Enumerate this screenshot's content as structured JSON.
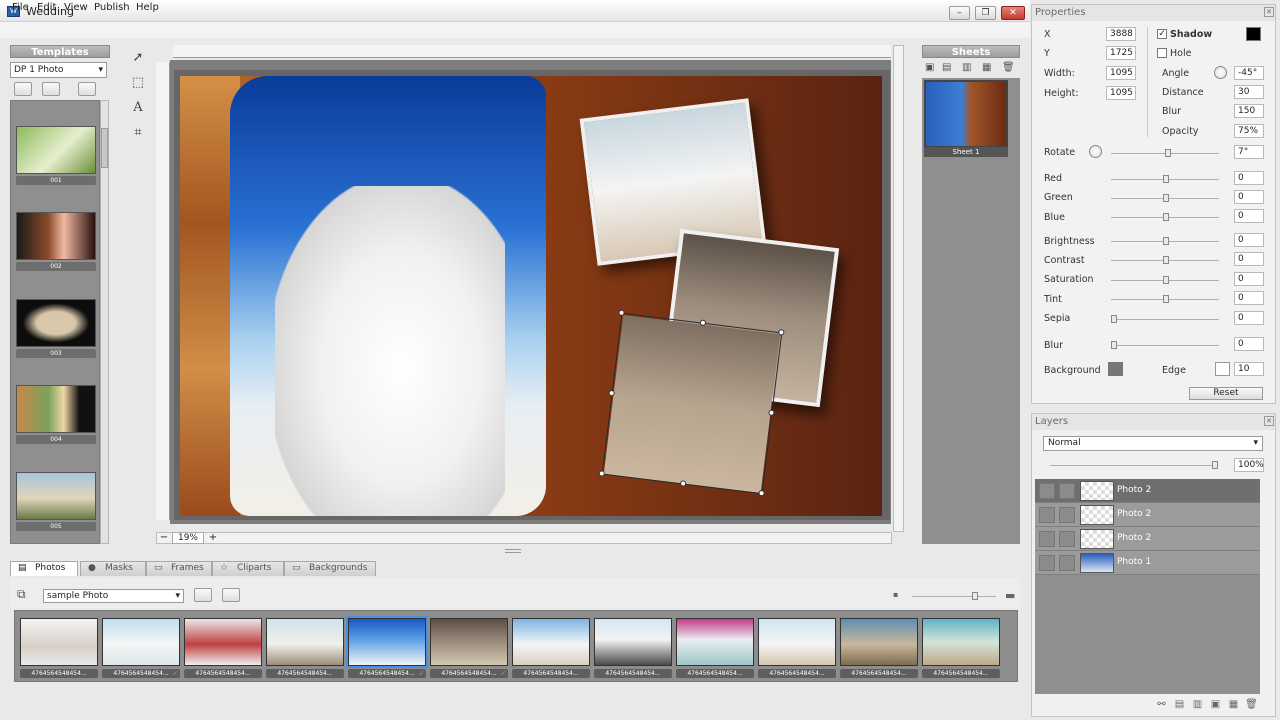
{
  "window": {
    "title": "Wedding",
    "app_icon": "app-logo-icon"
  },
  "menu": [
    "File",
    "Edit",
    "View",
    "Publish",
    "Help"
  ],
  "templates": {
    "header": "Templates",
    "selected": "DP 1 Photo",
    "items": [
      "001",
      "002",
      "003",
      "004",
      "005"
    ]
  },
  "tools": [
    "select-arrow-icon",
    "marquee-icon",
    "text-icon",
    "crop-icon"
  ],
  "canvas": {
    "zoom": "19%"
  },
  "sheets": {
    "header": "Sheets",
    "items": [
      "Sheet 1"
    ]
  },
  "bottom_tabs": [
    "Photos",
    "Masks",
    "Frames",
    "Cliparts",
    "Backgrounds"
  ],
  "photo_folder": "sample Photo",
  "photos": [
    {
      "label": "4764564548454...",
      "checked": false
    },
    {
      "label": "4764564548454...",
      "checked": true
    },
    {
      "label": "4764564548454...",
      "checked": false
    },
    {
      "label": "4764564548454...",
      "checked": false
    },
    {
      "label": "4764564548454...",
      "checked": true
    },
    {
      "label": "4764564548454...",
      "checked": true
    },
    {
      "label": "4764564548454...",
      "checked": false
    },
    {
      "label": "4764564548454...",
      "checked": false
    },
    {
      "label": "4764564548454...",
      "checked": false
    },
    {
      "label": "4764564548454...",
      "checked": false
    },
    {
      "label": "4764564548454...",
      "checked": false
    },
    {
      "label": "4764564548454...",
      "checked": false
    }
  ],
  "properties": {
    "title": "Properties",
    "x_label": "X",
    "x": "3888",
    "y_label": "Y",
    "y": "1725",
    "width_label": "Width:",
    "width": "1095",
    "height_label": "Height:",
    "height": "1095",
    "shadow_label": "Shadow",
    "shadow": true,
    "hole_label": "Hole",
    "hole": false,
    "angle_label": "Angle",
    "angle": "-45°",
    "distance_label": "Distance",
    "distance": "30",
    "blur_s_label": "Blur",
    "blur_s": "150",
    "opacity_label": "Opacity",
    "opacity": "75%",
    "rotate_label": "Rotate",
    "rotate": "7°",
    "red_label": "Red",
    "red": "0",
    "green_label": "Green",
    "green": "0",
    "blue_label": "Blue",
    "blue": "0",
    "brightness_label": "Brightness",
    "brightness": "0",
    "contrast_label": "Contrast",
    "contrast": "0",
    "saturation_label": "Saturation",
    "saturation": "0",
    "tint_label": "Tint",
    "tint": "0",
    "sepia_label": "Sepia",
    "sepia": "0",
    "blur_label": "Blur",
    "blur": "0",
    "background_label": "Background",
    "edge_label": "Edge",
    "edge": "10",
    "reset_label": "Reset",
    "shadow_color": "#000000"
  },
  "layers": {
    "title": "Layers",
    "blend": "Normal",
    "opacity": "100%",
    "items": [
      "Photo 2",
      "Photo 2",
      "Photo 2",
      "Photo 1"
    ]
  },
  "colors": {
    "accent_window": "#2b5ea8",
    "close": "#c23b2e",
    "panel_gray": "#8f8f8f"
  }
}
